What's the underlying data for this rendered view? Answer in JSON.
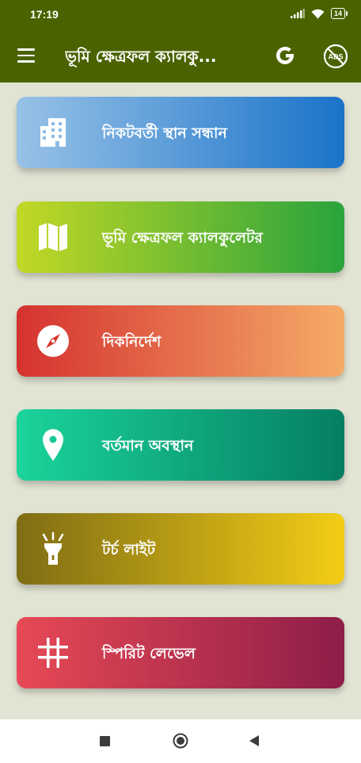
{
  "status_bar": {
    "time": "17:19",
    "battery": "14",
    "signal_icon": "signal-icon",
    "wifi_icon": "wifi-icon"
  },
  "toolbar": {
    "title": "ভূমি ক্ষেত্রফল ক্যালকু...",
    "menu_icon": "hamburger-menu-icon",
    "g_icon": "g-logo-icon",
    "ads_icon": "no-ads-icon"
  },
  "cards": [
    {
      "label": "নিকটবর্তী স্থান সন্ধান",
      "icon": "building-icon"
    },
    {
      "label": "ভূমি ক্ষেত্রফল ক্যালকুলেটর",
      "icon": "map-icon"
    },
    {
      "label": "দিকনির্দেশ",
      "icon": "compass-icon"
    },
    {
      "label": "বর্তমান অবস্থান",
      "icon": "location-pin-icon"
    },
    {
      "label": "টর্চ লাইট",
      "icon": "flashlight-icon"
    },
    {
      "label": "স্পিরিট লেভেল",
      "icon": "spirit-level-icon"
    }
  ],
  "colors": {
    "toolbar": "#4a6300",
    "background": "#e1e4d3"
  },
  "nav_bar": {
    "recents_icon": "recents-square-icon",
    "home_icon": "home-circle-icon",
    "back_icon": "back-triangle-icon"
  }
}
